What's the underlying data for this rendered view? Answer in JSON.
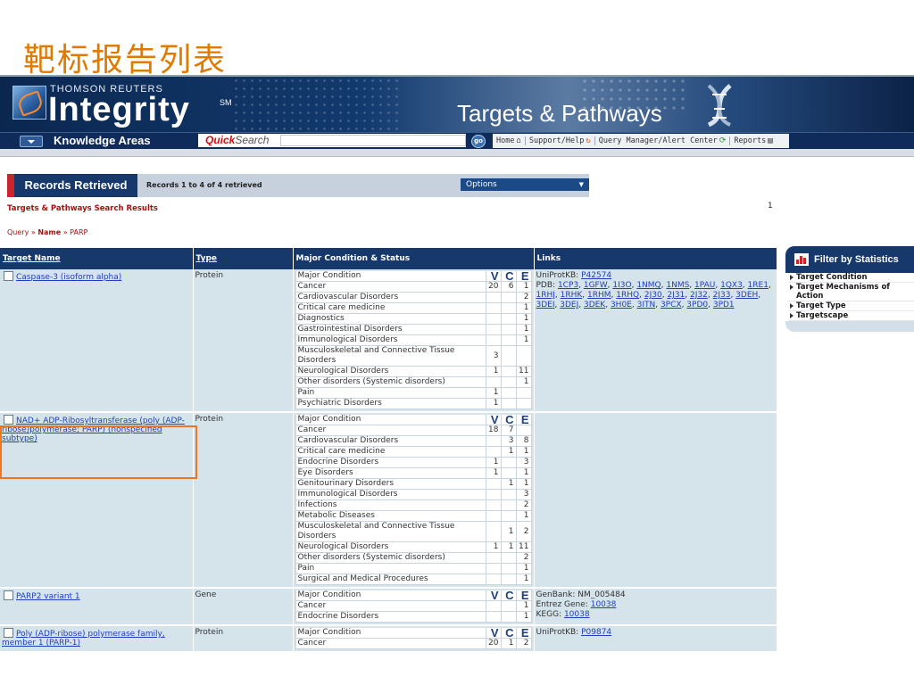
{
  "slide_title": "靶标报告列表",
  "banner": {
    "brand_top": "THOMSON REUTERS",
    "brand_name": "Integrity",
    "brand_sm": "SM",
    "product": "Targets & Pathways"
  },
  "nav": {
    "knowledge_areas": "Knowledge Areas",
    "quick": "Quick",
    "search": "Search",
    "go": "go",
    "links": [
      {
        "label": "Home",
        "icon": "⌂"
      },
      {
        "label": "Support/Help",
        "icon": "↻"
      },
      {
        "label": "Query Manager/Alert Center",
        "icon": "⟳"
      },
      {
        "label": "Reports",
        "icon": "▤"
      }
    ]
  },
  "records": {
    "title": "Records Retrieved",
    "count": "Records 1 to 4 of 4 retrieved",
    "options": "Options"
  },
  "results_label": "Targets & Pathways Search Results",
  "page_number": "1",
  "breadcrumb": {
    "query": "Query",
    "sep": "»",
    "field": "Name",
    "sep2": "»",
    "value": "PARP"
  },
  "table": {
    "headers": [
      "Target Name",
      "Type",
      "Major Condition & Status",
      "Links"
    ],
    "vce": [
      "V",
      "C",
      "E"
    ],
    "rows": [
      {
        "name": "Caspase-3 (isoform alpha)",
        "type": "Protein",
        "cond_header": "Major Condition",
        "conditions": [
          [
            "Cancer",
            "20",
            "6",
            "1"
          ],
          [
            "Cardiovascular Disorders",
            "",
            "",
            "2"
          ],
          [
            "Critical care medicine",
            "",
            "",
            "1"
          ],
          [
            "Diagnostics",
            "",
            "",
            "1"
          ],
          [
            "Gastrointestinal Disorders",
            "",
            "",
            "1"
          ],
          [
            "Immunological Disorders",
            "",
            "",
            "1"
          ],
          [
            "Musculoskeletal and Connective Tissue Disorders",
            "3",
            "",
            ""
          ],
          [
            "Neurological Disorders",
            "1",
            "",
            "11"
          ],
          [
            "Other disorders (Systemic disorders)",
            "",
            "",
            "1"
          ],
          [
            "Pain",
            "1",
            "",
            ""
          ],
          [
            "Psychiatric Disorders",
            "1",
            "",
            ""
          ]
        ],
        "links": [
          {
            "label": "UniProtKB:",
            "items": [
              "P42574"
            ]
          },
          {
            "label": "PDB:",
            "items": [
              "1CP3",
              "1GFW",
              "1I3O",
              "1NMQ",
              "1NMS",
              "1PAU",
              "1QX3",
              "1RE1",
              "1RHJ",
              "1RHK",
              "1RHM",
              "1RHQ",
              "2J30",
              "2J31",
              "2J32",
              "2J33",
              "3DEH",
              "3DEI",
              "3DEJ",
              "3DEK",
              "3H0E",
              "3ITN",
              "3PCX",
              "3PD0",
              "3PD1"
            ]
          }
        ]
      },
      {
        "name": "NAD+ ADP-Ribosyltransferase (poly (ADP-ribose)polymerase; PARP) (nonspecified subtype)",
        "type": "Protein",
        "cond_header": "Major Condition",
        "conditions": [
          [
            "Cancer",
            "18",
            "7",
            ""
          ],
          [
            "Cardiovascular Disorders",
            "",
            "3",
            "8"
          ],
          [
            "Critical care medicine",
            "",
            "1",
            "1"
          ],
          [
            "Endocrine Disorders",
            "1",
            "",
            "3"
          ],
          [
            "Eye Disorders",
            "1",
            "",
            "1"
          ],
          [
            "Genitourinary Disorders",
            "",
            "1",
            "1"
          ],
          [
            "Immunological Disorders",
            "",
            "",
            "3"
          ],
          [
            "Infections",
            "",
            "",
            "2"
          ],
          [
            "Metabolic Diseases",
            "",
            "",
            "1"
          ],
          [
            "Musculoskeletal and Connective Tissue Disorders",
            "",
            "1",
            "2"
          ],
          [
            "Neurological Disorders",
            "1",
            "1",
            "11"
          ],
          [
            "Other disorders (Systemic disorders)",
            "",
            "",
            "2"
          ],
          [
            "Pain",
            "",
            "",
            "1"
          ],
          [
            "Surgical and Medical Procedures",
            "",
            "",
            "1"
          ]
        ],
        "links": []
      },
      {
        "name": "PARP2 variant 1",
        "type": "Gene",
        "cond_header": "Major Condition",
        "conditions": [
          [
            "Cancer",
            "",
            "",
            "1"
          ],
          [
            "Endocrine Disorders",
            "",
            "",
            "1"
          ]
        ],
        "links": [
          {
            "label": "GenBank:",
            "text": "NM_005484"
          },
          {
            "label": "Entrez Gene:",
            "items": [
              "10038"
            ]
          },
          {
            "label": "KEGG:",
            "items": [
              "10038"
            ]
          }
        ]
      },
      {
        "name": "Poly (ADP-ribose) polymerase family, member 1 (PARP-1)",
        "type": "Protein",
        "cond_header": "Major Condition",
        "conditions": [
          [
            "Cancer",
            "20",
            "1",
            "2"
          ]
        ],
        "links": [
          {
            "label": "UniProtKB:",
            "items": [
              "P09874"
            ]
          }
        ]
      }
    ]
  },
  "filter": {
    "title": "Filter by Statistics",
    "items": [
      "Target Condition",
      "Target Mechanisms of Action",
      "Target Type",
      "Targetscape"
    ]
  }
}
